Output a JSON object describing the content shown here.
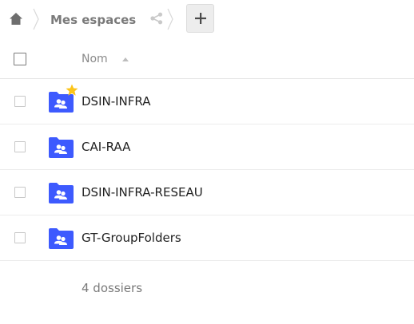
{
  "breadcrumb": {
    "home_icon": "home-icon",
    "current_label": "Mes espaces",
    "share_icon": "share-icon",
    "add_label": "+"
  },
  "file_list": {
    "header": {
      "name_column": "Nom",
      "sort_icon": "sort-ascending-icon"
    },
    "rows": [
      {
        "name": "DSIN-INFRA",
        "icon": "group-folder-icon",
        "favorite": true
      },
      {
        "name": "CAI-RAA",
        "icon": "group-folder-icon",
        "favorite": false
      },
      {
        "name": "DSIN-INFRA-RESEAU",
        "icon": "group-folder-icon",
        "favorite": false
      },
      {
        "name": "GT-GroupFolders",
        "icon": "group-folder-icon",
        "favorite": false
      }
    ],
    "summary": "4 dossiers"
  },
  "colors": {
    "folder": "#3d5afe",
    "star": "#fcc419",
    "muted_text": "#7a7a7a",
    "add_button_bg": "#ededed"
  }
}
